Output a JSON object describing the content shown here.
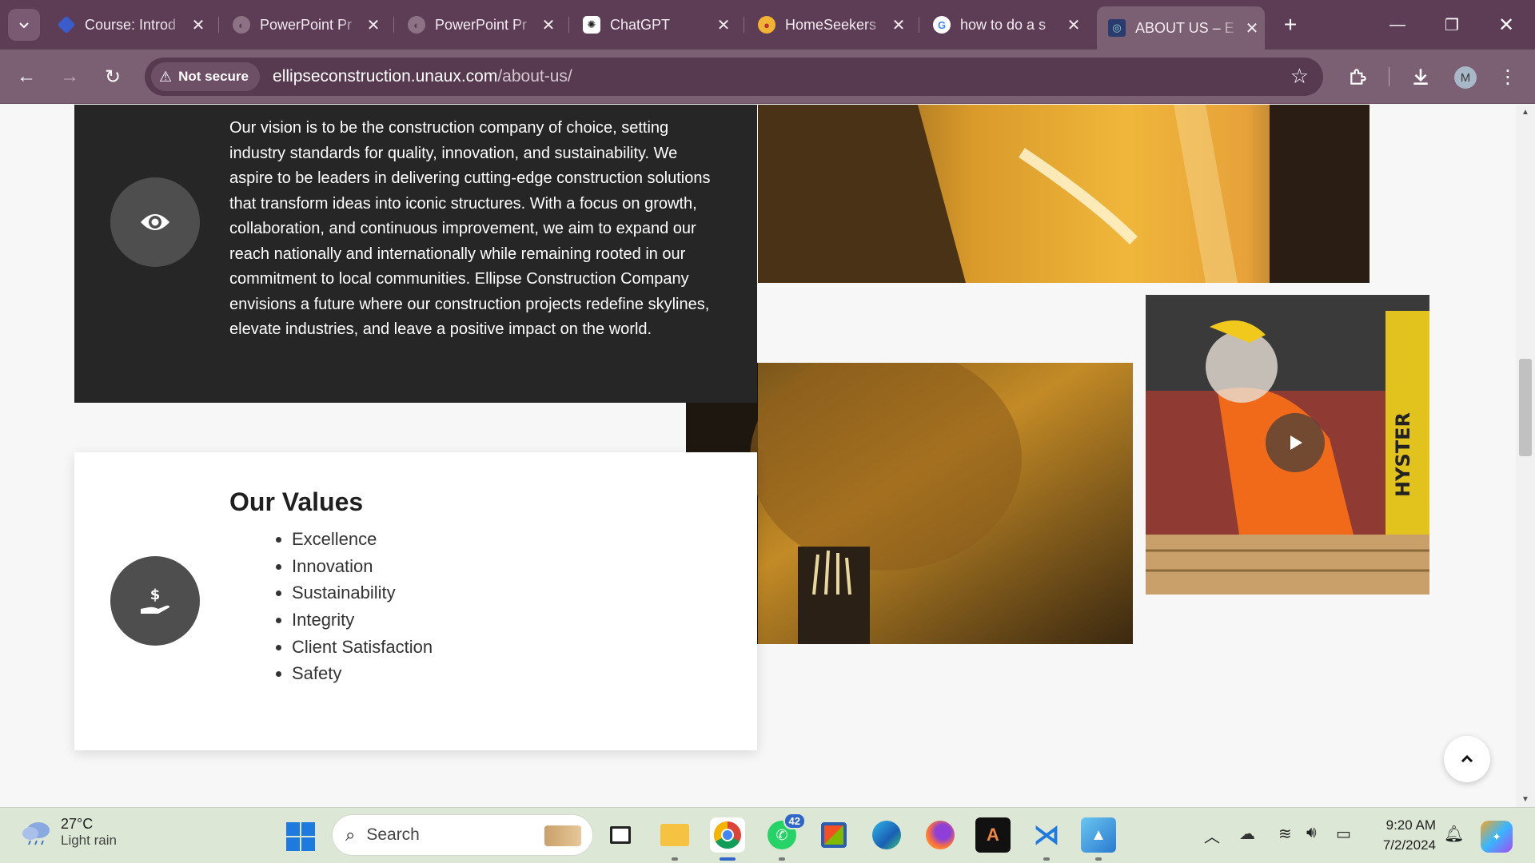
{
  "browser": {
    "tabs": [
      {
        "title": "Course: Introd",
        "icon": "course-icon"
      },
      {
        "title": "PowerPoint Pr",
        "icon": "globe-icon"
      },
      {
        "title": "PowerPoint Pr",
        "icon": "globe-icon"
      },
      {
        "title": "ChatGPT",
        "icon": "chatgpt-icon"
      },
      {
        "title": "HomeSeekers",
        "icon": "homeseekers-icon"
      },
      {
        "title": "how to do a s",
        "icon": "google-icon"
      },
      {
        "title": "ABOUT US – E",
        "icon": "ellipse-site-icon",
        "active": true
      }
    ],
    "security_label": "Not secure",
    "url_domain": "ellipseconstruction.unaux.com",
    "url_path": "/about-us/",
    "profile_initial": "M"
  },
  "page": {
    "vision_text": "Our vision is to be the construction company of choice, setting industry standards for quality, innovation, and sustainability. We aspire to be leaders in delivering cutting-edge construction solutions that transform ideas into iconic structures. With a focus on growth, collaboration, and continuous improvement, we aim to expand our reach nationally and internationally while remaining rooted in our commitment to local communities. Ellipse Construction Company envisions a future where our construction projects redefine skylines, elevate industries, and leave a positive impact on the world.",
    "values_title": "Our Values",
    "values": [
      "Excellence",
      "Innovation",
      "Sustainability",
      "Integrity",
      "Client Satisfaction",
      "Safety"
    ],
    "photo_text": "HYSTER"
  },
  "taskbar": {
    "temperature": "27°C",
    "condition": "Light rain",
    "search_label": "Search",
    "whatsapp_badge": "42",
    "time": "9:20 AM",
    "date": "7/2/2024"
  }
}
